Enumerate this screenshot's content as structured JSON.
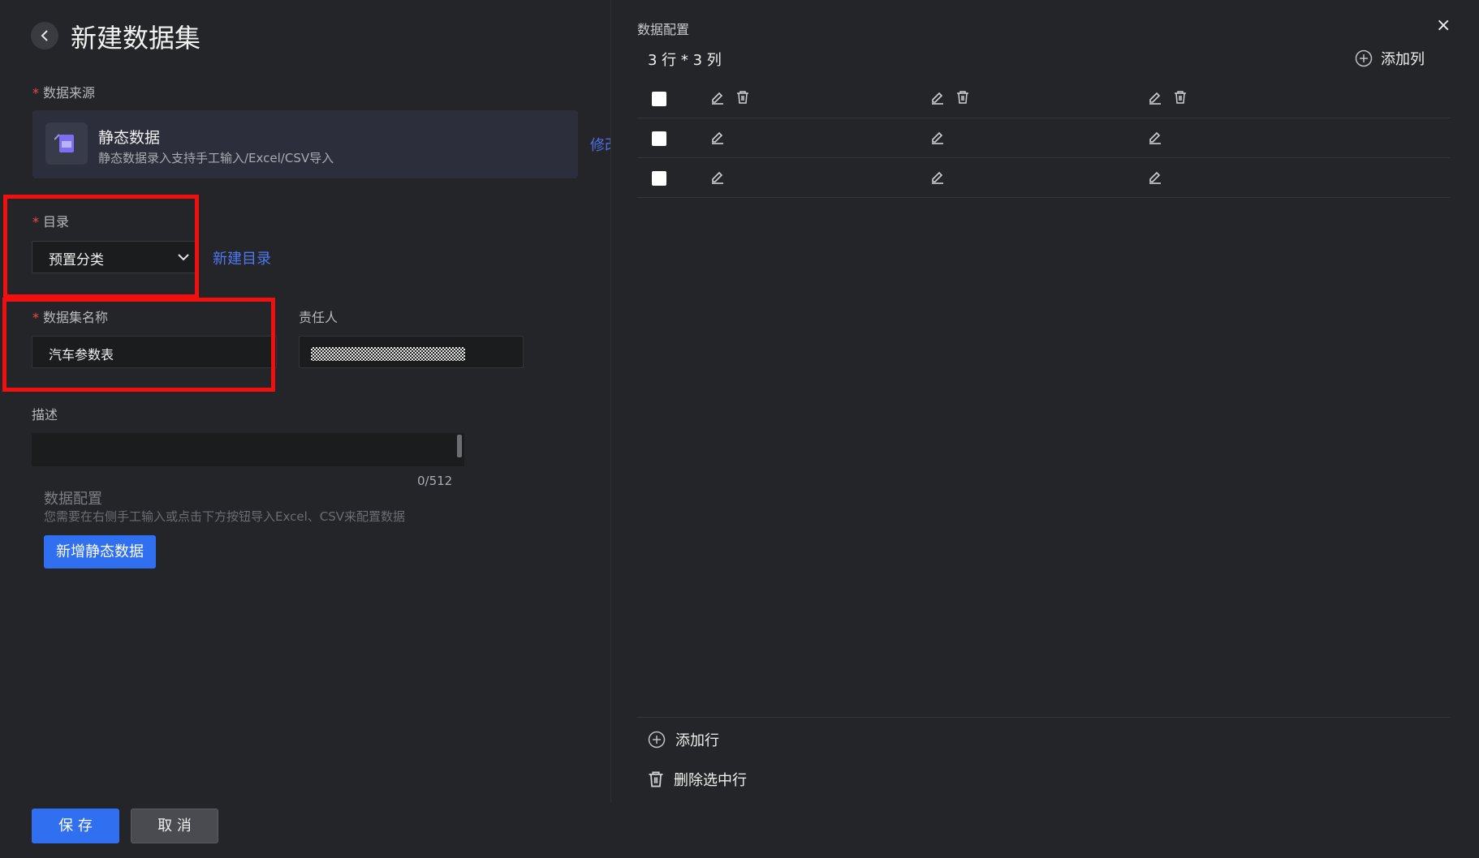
{
  "header": {
    "title": "新建数据集"
  },
  "source": {
    "label": "数据来源",
    "name": "静态数据",
    "desc": "静态数据录入支持手工输入/Excel/CSV导入",
    "modify_link": "修改"
  },
  "catalog": {
    "label": "目录",
    "value": "预置分类",
    "new_link": "新建目录"
  },
  "dataset_name": {
    "label": "数据集名称",
    "value": "汽车参数表"
  },
  "owner": {
    "label": "责任人"
  },
  "description": {
    "label": "描述",
    "counter": "0/512"
  },
  "config": {
    "title": "数据配置",
    "desc": "您需要在右侧手工输入或点击下方按钮导入Excel、CSV来配置数据",
    "add_button": "新增静态数据"
  },
  "footer": {
    "save": "保 存",
    "cancel": "取 消"
  },
  "panel": {
    "title": "数据配置",
    "close": "×",
    "dims": "3 行 * 3 列",
    "add_col": "添加列",
    "add_row": "添加行",
    "delete_rows": "删除选中行"
  },
  "colors": {
    "accent": "#2f6ff0",
    "link": "#4f78f0",
    "highlight": "#f20f0f",
    "required": "#f04848"
  }
}
